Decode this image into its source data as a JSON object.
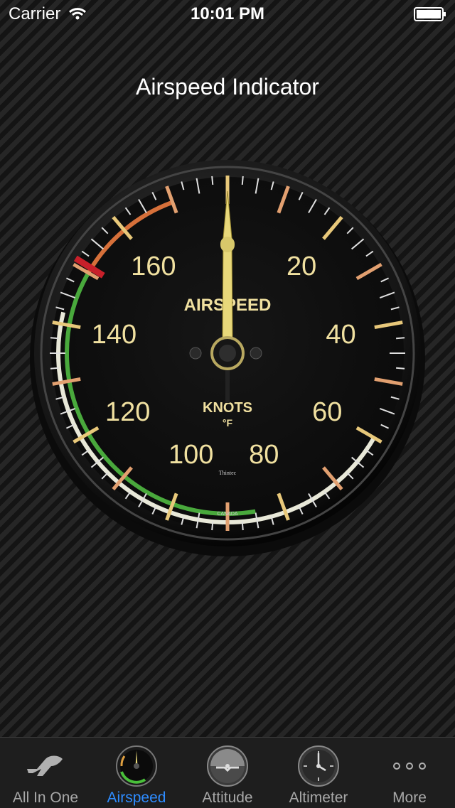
{
  "status_bar": {
    "carrier": "Carrier",
    "time": "10:01 PM"
  },
  "title": "Airspeed Indicator",
  "gauge": {
    "face_title": "AIRSPEED",
    "units": "KNOTS",
    "units_sub": "°F",
    "brand": "Thintec",
    "origin": "CANADA",
    "dial_labels": [
      "20",
      "40",
      "60",
      "80",
      "100",
      "120",
      "140",
      "160"
    ],
    "needle_value": 0,
    "colors": {
      "green_arc": "#49a93c",
      "white_arc": "#e8e8d8",
      "red_line": "#c8202a",
      "yellow_arc": "#d6703a",
      "numeral": "#f0e0a0"
    }
  },
  "tabs": [
    {
      "label": "All In One",
      "icon": "airplane-icon",
      "active": false
    },
    {
      "label": "Airspeed",
      "icon": "airspeed-gauge-icon",
      "active": true
    },
    {
      "label": "Attitude",
      "icon": "attitude-gauge-icon",
      "active": false
    },
    {
      "label": "Altimeter",
      "icon": "altimeter-gauge-icon",
      "active": false
    },
    {
      "label": "More",
      "icon": "more-icon",
      "active": false
    }
  ]
}
